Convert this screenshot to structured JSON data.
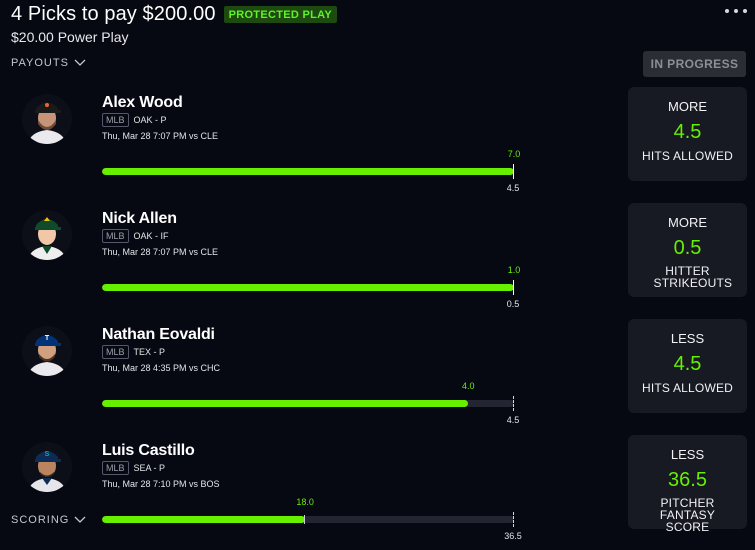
{
  "header": {
    "title": "4 Picks to pay $200.00",
    "badge": "PROTECTED PLAY",
    "subtitle": "$20.00 Power Play"
  },
  "payouts_label": "PAYOUTS",
  "scoring_label": "SCORING",
  "status": "IN PROGRESS",
  "colors": {
    "accent": "#66f000",
    "background": "#060812",
    "card": "#171923"
  },
  "picks": [
    {
      "name": "Alex Wood",
      "league": "MLB",
      "team_pos": "OAK - P",
      "game": "Thu, Mar 28 7:07 PM  vs CLE",
      "current": "7.0",
      "line_label": "4.5",
      "progress_fraction": 1.0,
      "direction": "MORE",
      "line": "4.5",
      "stat": "HITS ALLOWED"
    },
    {
      "name": "Nick Allen",
      "league": "MLB",
      "team_pos": "OAK - IF",
      "game": "Thu, Mar 28 7:07 PM  vs CLE",
      "current": "1.0",
      "line_label": "0.5",
      "progress_fraction": 1.0,
      "direction": "MORE",
      "line": "0.5",
      "stat": "HITTER STRIKEOUTS"
    },
    {
      "name": "Nathan Eovaldi",
      "league": "MLB",
      "team_pos": "TEX - P",
      "game": "Thu, Mar 28 4:35 PM  vs CHC",
      "current": "4.0",
      "line_label": "4.5",
      "progress_fraction": 0.889,
      "direction": "LESS",
      "line": "4.5",
      "stat": "HITS ALLOWED"
    },
    {
      "name": "Luis Castillo",
      "league": "MLB",
      "team_pos": "SEA - P",
      "game": "Thu, Mar 28 7:10 PM  vs BOS",
      "current": "18.0",
      "line_label": "36.5",
      "progress_fraction": 0.493,
      "direction": "LESS",
      "line": "36.5",
      "stat": "PITCHER FANTASY SCORE"
    }
  ]
}
